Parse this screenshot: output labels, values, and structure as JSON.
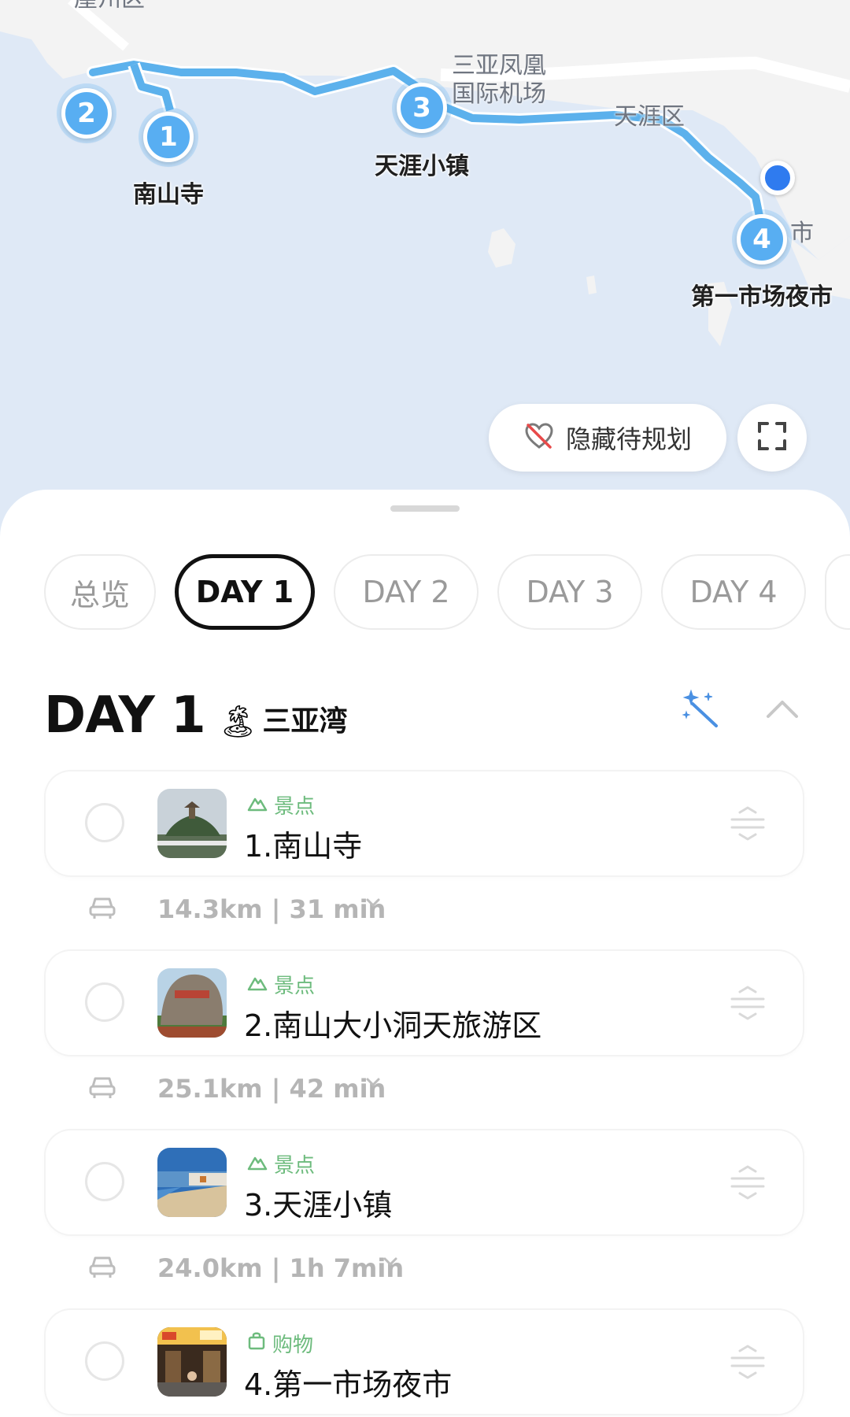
{
  "map": {
    "area_labels": {
      "top_left": "崖州区",
      "airport": "三亚凤凰\n国际机场",
      "tianya": "天涯区",
      "right_partial": "市"
    },
    "stops": [
      {
        "number": "1",
        "label": "南山寺"
      },
      {
        "number": "2",
        "label": ""
      },
      {
        "number": "3",
        "label": "天涯小镇"
      },
      {
        "number": "4",
        "label": "第一市场夜市"
      }
    ],
    "hide_plan_button": "隐藏待规划",
    "colors": {
      "route": "#5cb1ec",
      "marker": "#58aef2",
      "water": "#dfe9f6",
      "land": "#f2f2f2",
      "my_location": "#2f7bef"
    }
  },
  "tabs": [
    {
      "label": "总览"
    },
    {
      "label": "DAY 1",
      "active": true
    },
    {
      "label": "DAY 2"
    },
    {
      "label": "DAY 3"
    },
    {
      "label": "DAY 4"
    }
  ],
  "day": {
    "title": "DAY 1",
    "emoji": "🏝",
    "subtitle": "三亚湾"
  },
  "itinerary": [
    {
      "category": "景点",
      "category_icon": "mountain-icon",
      "name": "1.南山寺",
      "transit": "14.3km | 31 min"
    },
    {
      "category": "景点",
      "category_icon": "mountain-icon",
      "name": "2.南山大小洞天旅游区",
      "transit": "25.1km | 42 min"
    },
    {
      "category": "景点",
      "category_icon": "mountain-icon",
      "name": "3.天涯小镇",
      "transit": "24.0km | 1h 7min"
    },
    {
      "category": "购物",
      "category_icon": "shopping-bag-icon",
      "name": "4.第一市场夜市"
    }
  ],
  "accent_green": "#6dbb7d"
}
